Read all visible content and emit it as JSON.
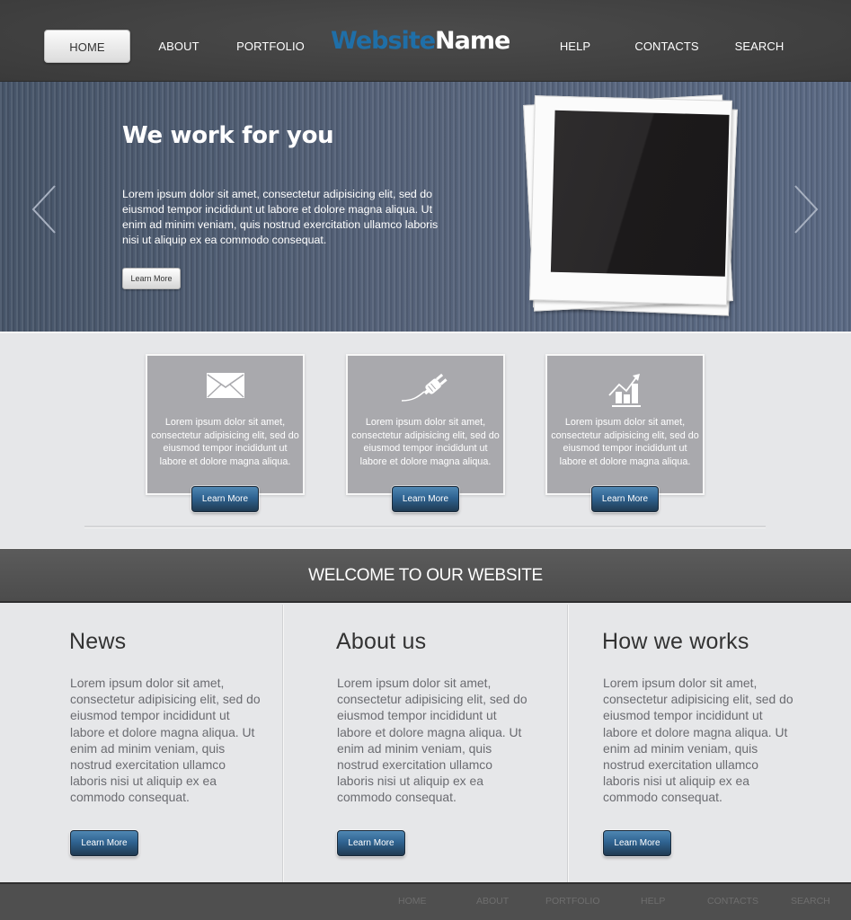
{
  "header": {
    "logo": {
      "part1": "Website",
      "part2": "Name",
      "part1_color": "#1f6fa8",
      "part2_color": "#ffffff"
    },
    "nav": [
      {
        "label": "HOME",
        "active": true
      },
      {
        "label": "ABOUT",
        "active": false
      },
      {
        "label": "PORTFOLIO",
        "active": false
      },
      {
        "label": "HELP",
        "active": false
      },
      {
        "label": "CONTACTS",
        "active": false
      },
      {
        "label": "SEARCH",
        "active": false
      }
    ]
  },
  "hero": {
    "title": "We work for you",
    "text": "Lorem ipsum dolor sit amet, consectetur adipisicing elit, sed do eiusmod tempor incididunt ut labore et dolore magna aliqua. Ut enim ad minim veniam, quis nostrud exercitation ullamco laboris nisi ut aliquip ex ea commodo consequat.",
    "button": "Learn More",
    "prev_icon": "chevron-left-icon",
    "next_icon": "chevron-right-icon",
    "image": "polaroid-photo-stack"
  },
  "features": [
    {
      "icon": "envelope-icon",
      "text": "Lorem ipsum dolor sit amet, consectetur adipisicing elit, sed do eiusmod tempor incididunt ut labore et dolore magna aliqua.",
      "button": "Learn More"
    },
    {
      "icon": "plug-icon",
      "text": "Lorem ipsum dolor sit amet, consectetur adipisicing elit, sed do eiusmod tempor incididunt ut labore et dolore magna aliqua.",
      "button": "Learn More"
    },
    {
      "icon": "growth-chart-icon",
      "text": "Lorem ipsum dolor sit amet, consectetur adipisicing elit, sed do eiusmod tempor incididunt ut labore et dolore magna aliqua.",
      "button": "Learn More"
    }
  ],
  "welcome": {
    "title": "WELCOME TO OUR WEBSITE"
  },
  "columns": [
    {
      "title": "News",
      "text": "Lorem ipsum dolor sit amet, consectetur adipisicing elit, sed do eiusmod tempor incididunt ut labore et dolore magna aliqua. Ut enim ad minim veniam, quis nostrud exercitation ullamco laboris nisi ut aliquip ex ea commodo consequat.",
      "button": "Learn More"
    },
    {
      "title": "About us",
      "text": "Lorem ipsum dolor sit amet, consectetur adipisicing elit, sed do eiusmod tempor incididunt ut labore et dolore magna aliqua. Ut enim ad minim veniam, quis nostrud exercitation ullamco laboris nisi ut aliquip ex ea commodo consequat.",
      "button": "Learn More"
    },
    {
      "title": "How we works",
      "text": "Lorem ipsum dolor sit amet, consectetur adipisicing elit, sed do eiusmod tempor incididunt ut labore et dolore magna aliqua. Ut enim ad minim veniam, quis nostrud exercitation ullamco laboris nisi ut aliquip ex ea commodo consequat.",
      "button": "Learn More"
    }
  ],
  "footer": {
    "nav": [
      "HOME",
      "ABOUT",
      "PORTFOLIO",
      "HELP",
      "CONTACTS",
      "SEARCH"
    ]
  },
  "colors": {
    "header_bg": "#444444",
    "hero_bg": "#56637a",
    "feature_box_bg": "#a9a9ad",
    "button_blue": "#2f6391",
    "page_bg": "#e6e7e9",
    "welcome_bg": "#555555",
    "footer_bg": "#4f4f4f"
  }
}
